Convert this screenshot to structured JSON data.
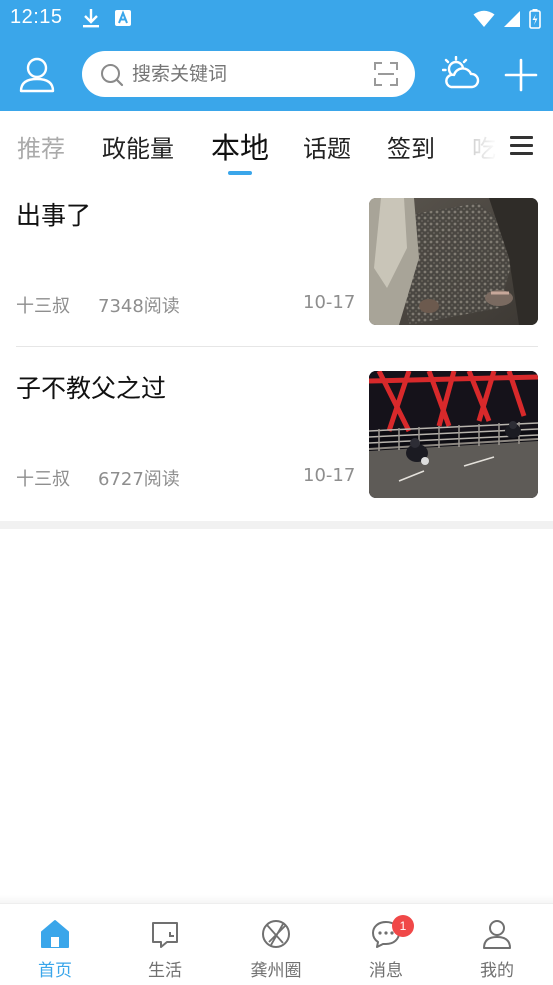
{
  "status_bar": {
    "time": "12:15"
  },
  "header": {
    "search": {
      "placeholder": "搜索关键词"
    }
  },
  "tabs": [
    {
      "label": "推荐",
      "active": false
    },
    {
      "label": "政能量",
      "active": false
    },
    {
      "label": "本地",
      "active": true
    },
    {
      "label": "话题",
      "active": false
    },
    {
      "label": "签到",
      "active": false
    },
    {
      "label": "吃",
      "active": false
    }
  ],
  "news": [
    {
      "title": "出事了",
      "author": "十三叔",
      "reads": "7348阅读",
      "date": "10-17",
      "thumbnail": "night-street-photo"
    },
    {
      "title": "子不教父之过",
      "author": "十三叔",
      "reads": "6727阅读",
      "date": "10-17",
      "thumbnail": "bridge-motorcycle-photo"
    }
  ],
  "bottom_nav": [
    {
      "label": "首页",
      "icon": "home-icon",
      "active": true
    },
    {
      "label": "生活",
      "icon": "life-icon",
      "active": false
    },
    {
      "label": "龚州圈",
      "icon": "aperture-icon",
      "active": false
    },
    {
      "label": "消息",
      "icon": "message-icon",
      "active": false,
      "badge": "1"
    },
    {
      "label": "我的",
      "icon": "user-icon",
      "active": false
    }
  ],
  "colors": {
    "brand": "#3aa6ea",
    "badge": "#f04848"
  }
}
